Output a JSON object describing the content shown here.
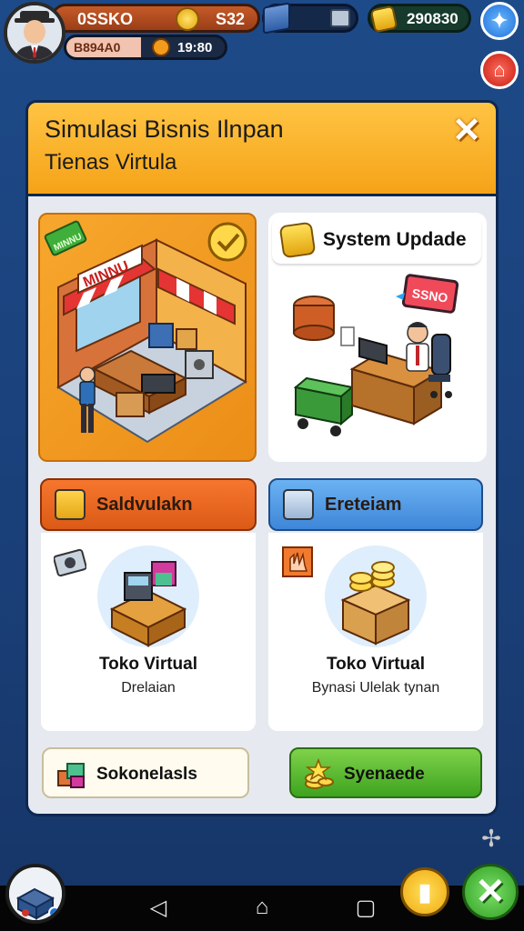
{
  "hud": {
    "player_name": "0SSKO",
    "coins": "S32",
    "sub_label": "B894A0",
    "timer": "19:80",
    "gems": "290830"
  },
  "dialog": {
    "title_line1": "Simulasi Bisnis Ilnpan",
    "title_line2": "Tienas Virtula",
    "close_label": "✕"
  },
  "shop_card": {
    "tag": "MINNU",
    "sign": "MINNU"
  },
  "update_card": {
    "label": "System Updade",
    "screen_text": "SSNO"
  },
  "tabs": {
    "left_label": "Saldvulakn",
    "right_label": "Ereteiam"
  },
  "items": {
    "left_title": "Toko Virtual",
    "left_sub": "Drelaian",
    "right_title": "Toko Virtual",
    "right_sub": "Bynasi Ulelak tynan"
  },
  "buttons": {
    "left_label": "Sokonelasls",
    "right_label": "Syenaede"
  },
  "colors": {
    "header": "#f5a318",
    "orange_tab": "#db5a16",
    "blue_tab": "#3e86d8",
    "green_button": "#3ea31f",
    "background": "#1a3f78"
  },
  "icons": {
    "top_right": "star-badge-icon",
    "home": "home-icon",
    "bottom_yellow": "trophy-icon",
    "bottom_green": "close-icon"
  }
}
